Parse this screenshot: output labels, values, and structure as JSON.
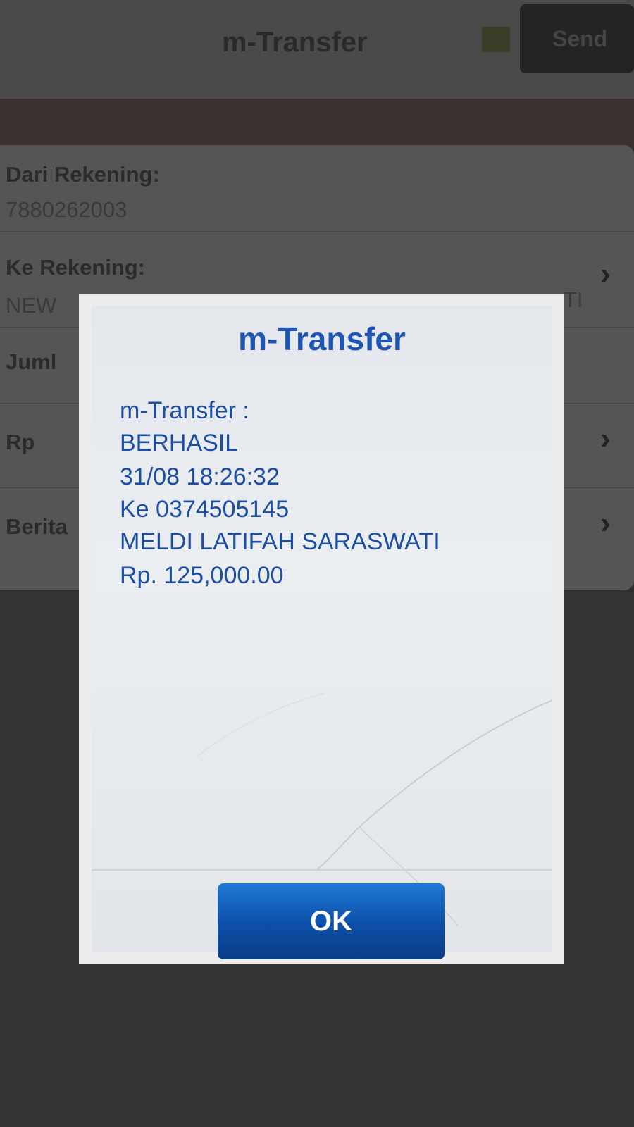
{
  "header": {
    "title": "m-Transfer",
    "send_label": "Send"
  },
  "form": {
    "from_label": "Dari Rekening:",
    "from_value": "7880262003",
    "to_label": "Ke Rekening:",
    "to_value_start": "NEW",
    "to_value_end": "TI",
    "amount_label_partial": "Juml",
    "currency_label": "Rp",
    "message_label_partial": "Berita"
  },
  "dialog": {
    "title": "m-Transfer",
    "lines": [
      "m-Transfer :",
      "BERHASIL",
      "31/08 18:26:32",
      "Ke 0374505145",
      "MELDI LATIFAH SARASWATI",
      "Rp. 125,000.00"
    ],
    "ok_label": "OK"
  },
  "colors": {
    "dialog_text": "#1d4ea3",
    "ok_button": "#0d4fa8"
  }
}
